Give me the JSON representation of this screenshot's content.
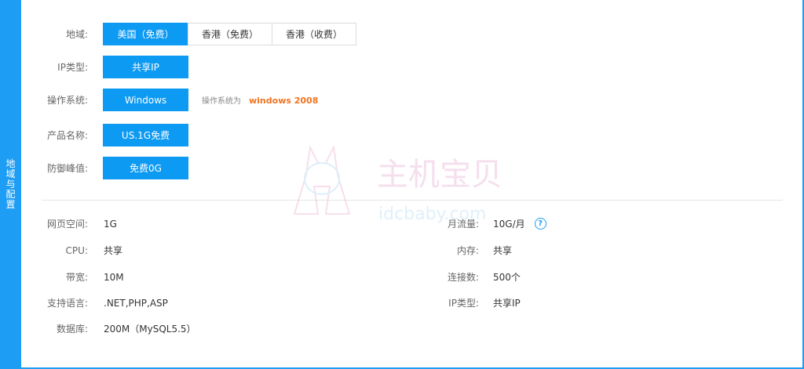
{
  "sidebar": {
    "label": "地域与配置"
  },
  "config": {
    "region": {
      "label": "地域:",
      "options": [
        "美国（免费）",
        "香港（免费）",
        "香港（收费）"
      ]
    },
    "ip_type": {
      "label": "IP类型:",
      "option": "共享IP"
    },
    "os": {
      "label": "操作系统:",
      "option": "Windows",
      "hint_prefix": "操作系统为",
      "hint_value": "windows 2008"
    },
    "product": {
      "label": "产品名称:",
      "option": "US.1G免费"
    },
    "defense": {
      "label": "防御峰值:",
      "option": "免费0G"
    }
  },
  "specs": {
    "left": [
      {
        "key": "网页空间:",
        "value": "1G"
      },
      {
        "key": "CPU:",
        "value": "共享"
      },
      {
        "key": "带宽:",
        "value": "10M"
      },
      {
        "key": "支持语言:",
        "value": ".NET,PHP,ASP"
      },
      {
        "key": "数据库:",
        "value": "200M（MySQL5.5）"
      }
    ],
    "right": [
      {
        "key": "月流量:",
        "value": "10G/月"
      },
      {
        "key": "内存:",
        "value": "共享"
      },
      {
        "key": "连接数:",
        "value": "500个"
      },
      {
        "key": "IP类型:",
        "value": "共享IP"
      }
    ],
    "help_glyph": "?"
  },
  "watermark": {
    "logo_text": "主机宝贝",
    "site_text": "idcbaby.com"
  },
  "colors": {
    "accent": "#0d9af2",
    "hint": "#f07320",
    "border": "#1e9df4"
  }
}
